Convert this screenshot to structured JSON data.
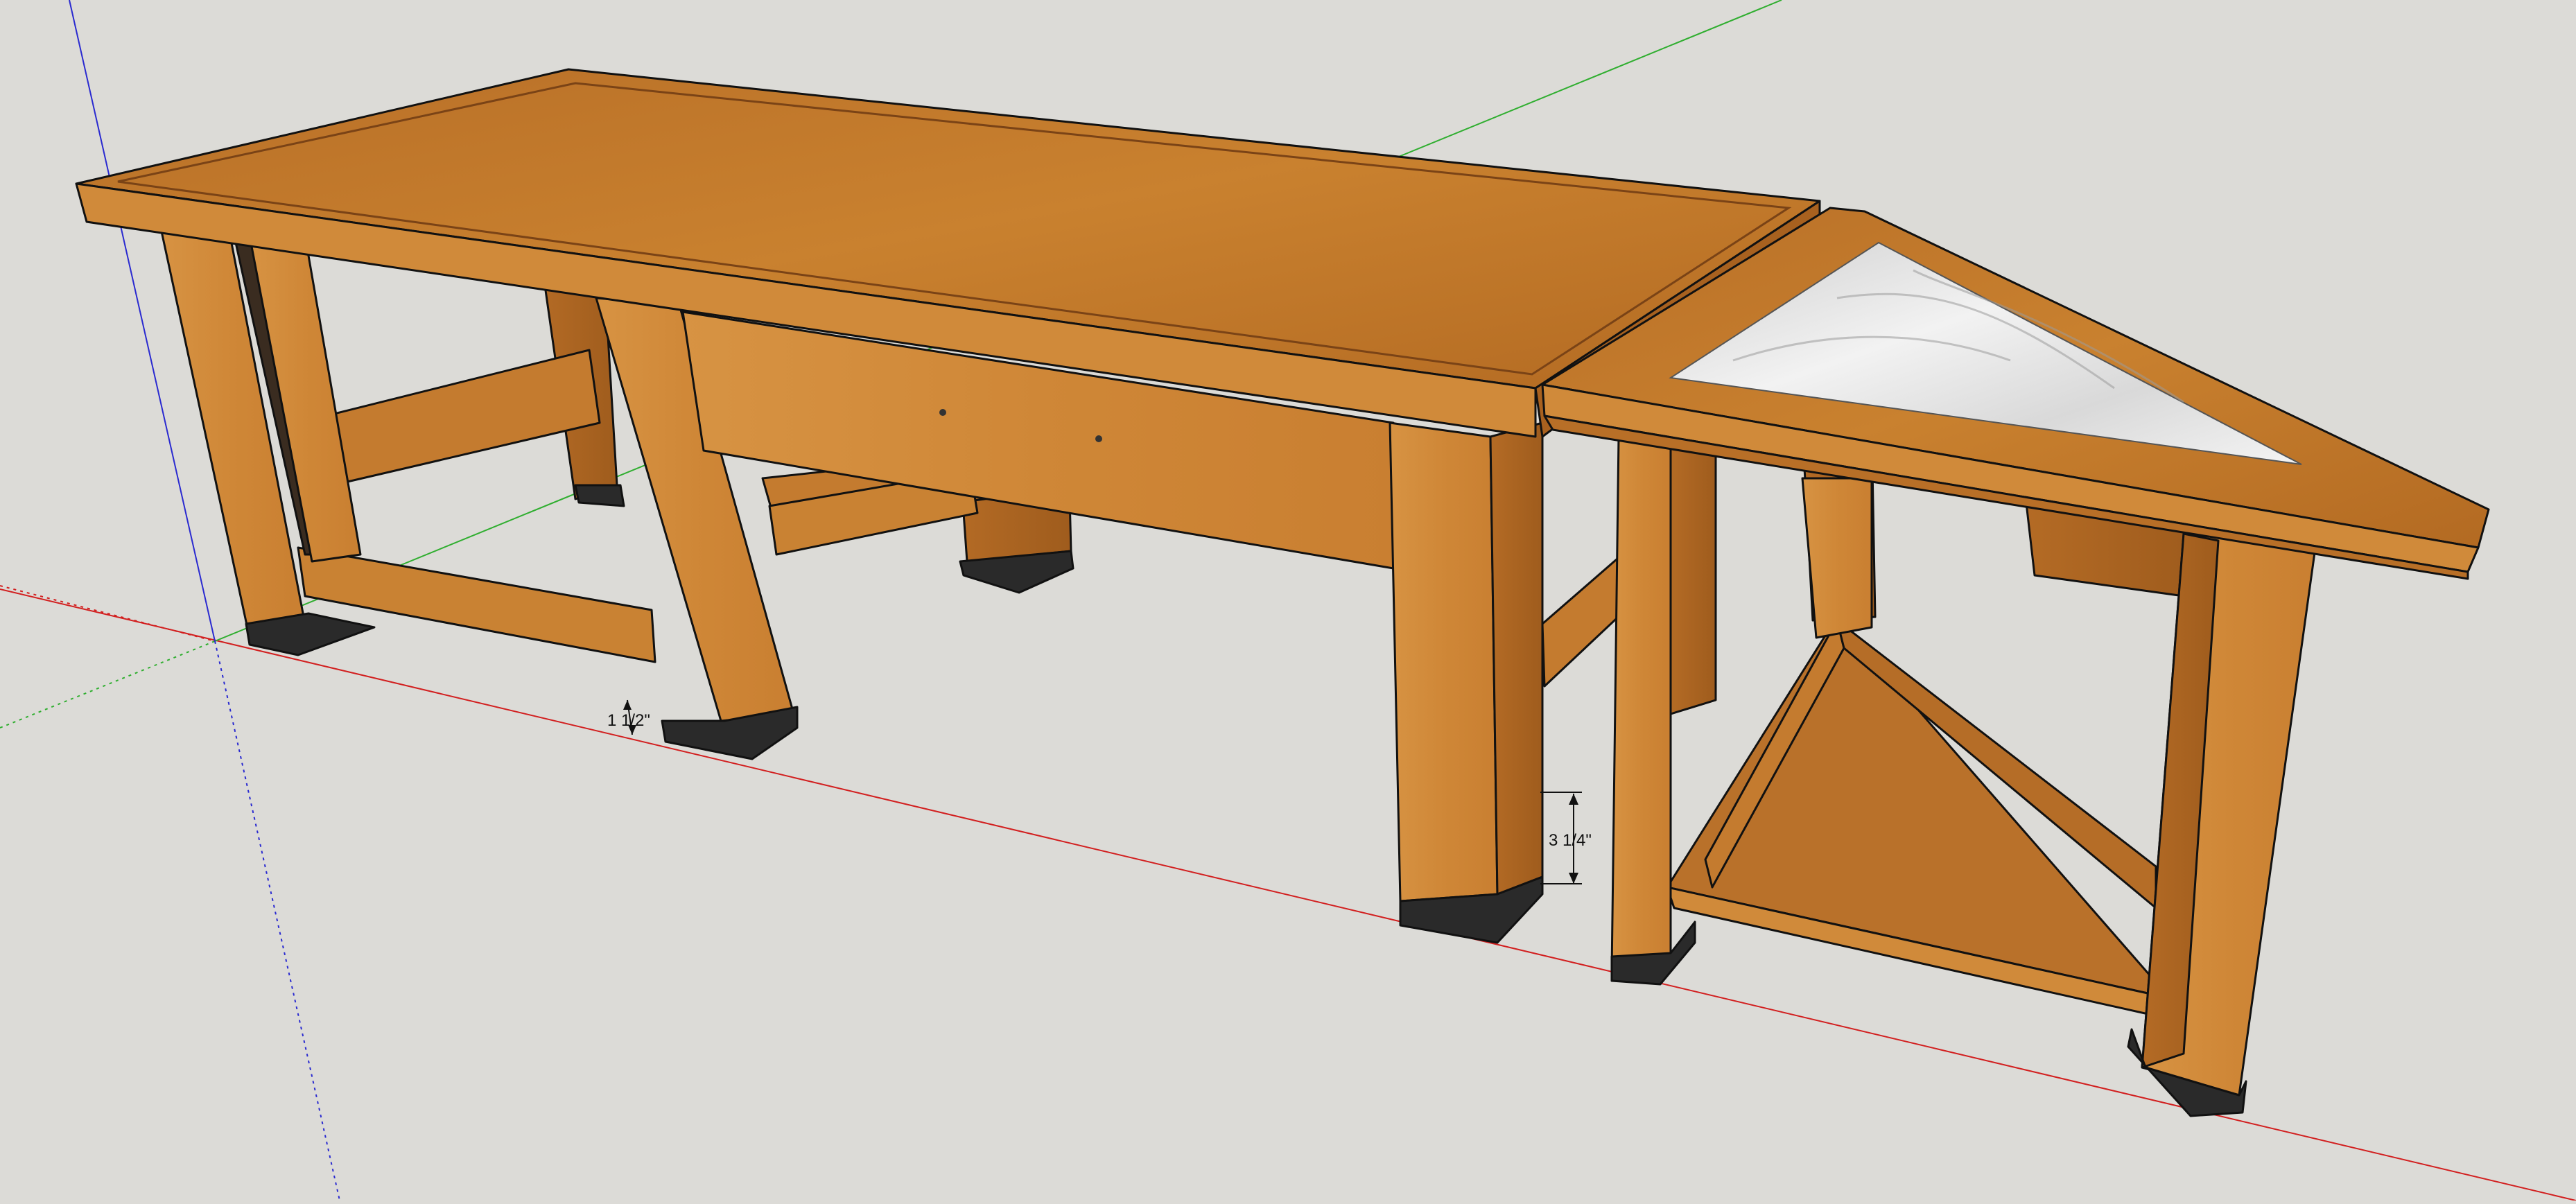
{
  "dimensions": {
    "lower_stretcher_offset": "1 1/2\"",
    "side_table_gap": "3 1/4\""
  },
  "colors": {
    "background": "#dcdbd7",
    "wood_top": "#c07a2e",
    "wood_face": "#d18a3c",
    "wood_dark": "#a8611f",
    "wood_shadow": "#8f541f",
    "foot_pad": "#2a2a2a",
    "marble": "#e7e7e7",
    "axis_red": "#d21f1f",
    "axis_green": "#2fae2f",
    "axis_blue": "#2a2ad0"
  },
  "scene": {
    "model": "woodworking-bench-with-corner-side-table",
    "icons": [
      "x-axis-icon",
      "y-axis-icon",
      "z-axis-icon"
    ]
  }
}
